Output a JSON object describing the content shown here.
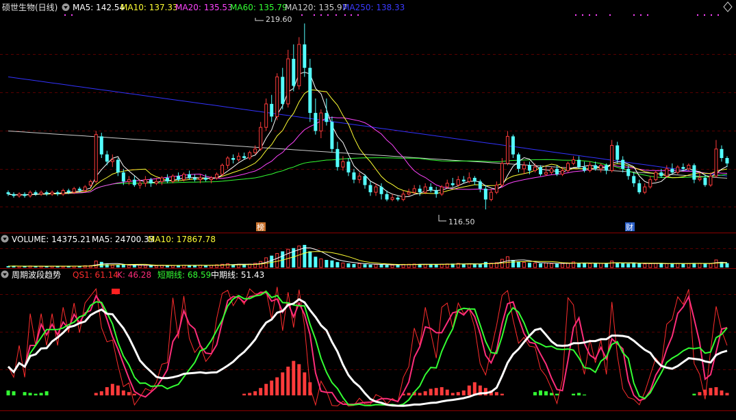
{
  "colors": {
    "up": "#ff3b3b",
    "down": "#54ffff",
    "grid": "#5a0000",
    "ma5": "#ffffff",
    "ma10": "#ffff33",
    "ma20": "#ff44ff",
    "ma60": "#33ff33",
    "ma120": "#cccccc",
    "ma250": "#3333ff",
    "qs1": "#ff2d2d",
    "k": "#ff2d7a",
    "short": "#33ff33",
    "mid": "#ffffff"
  },
  "header": {
    "title": "硕世生物(日线)",
    "ma5": "MA5: 142.54",
    "ma10": "MA10: 137.33",
    "ma20": "MA20: 135.53",
    "ma60": "MA60: 135.79",
    "ma120": "MA120: 135.97",
    "ma250": "MA250: 138.33"
  },
  "price_panel": {
    "high_label": "219.60",
    "low_label": "116.50",
    "marker1": "榜",
    "marker2": "财"
  },
  "volume_panel": {
    "label": "VOLUME: 14375.21",
    "ma5": "MA5: 24700.33",
    "ma10": "MA10: 17867.78"
  },
  "indicator_panel": {
    "name": "周期波段趋势",
    "qs1": "QS1: 61.14",
    "k": "K: 46.28",
    "short": "短期线: 68.59",
    "mid": "中期线: 51.43"
  },
  "chart_data": {
    "type": "candlestick",
    "candles": [
      [
        126,
        125,
        127,
        124
      ],
      [
        125,
        124,
        126,
        123
      ],
      [
        124,
        125,
        126,
        123
      ],
      [
        125,
        124,
        126,
        123
      ],
      [
        124,
        126,
        127,
        123
      ],
      [
        126,
        125,
        127,
        124
      ],
      [
        125,
        126,
        127,
        124
      ],
      [
        126,
        125,
        127,
        124
      ],
      [
        125,
        126,
        127,
        124
      ],
      [
        126,
        125,
        127,
        124
      ],
      [
        125,
        127,
        128,
        124
      ],
      [
        127,
        126,
        128,
        125
      ],
      [
        126,
        128,
        129,
        125
      ],
      [
        128,
        127,
        129,
        126
      ],
      [
        127,
        129,
        130,
        126
      ],
      [
        130,
        132,
        133,
        129
      ],
      [
        132,
        158,
        160,
        131
      ],
      [
        157,
        147,
        159,
        145
      ],
      [
        147,
        143,
        149,
        141
      ],
      [
        143,
        144,
        147,
        140
      ],
      [
        144,
        137,
        145,
        135
      ],
      [
        137,
        132,
        139,
        130
      ],
      [
        132,
        133,
        135,
        130
      ],
      [
        133,
        130,
        135,
        129
      ],
      [
        130,
        131,
        133,
        128
      ],
      [
        131,
        133,
        135,
        129
      ],
      [
        133,
        131,
        134,
        129
      ],
      [
        131,
        132,
        134,
        130
      ],
      [
        132,
        134,
        135,
        130
      ],
      [
        134,
        132,
        136,
        131
      ],
      [
        132,
        135,
        136,
        131
      ],
      [
        135,
        133,
        137,
        132
      ],
      [
        133,
        136,
        137,
        132
      ],
      [
        136,
        134,
        138,
        133
      ],
      [
        134,
        133,
        136,
        132
      ],
      [
        133,
        134,
        136,
        131
      ],
      [
        134,
        133,
        136,
        132
      ],
      [
        133,
        134,
        135,
        131
      ],
      [
        134,
        136,
        137,
        133
      ],
      [
        136,
        141,
        142,
        135
      ],
      [
        141,
        145,
        146,
        139
      ],
      [
        145,
        144,
        147,
        142
      ],
      [
        144,
        146,
        148,
        143
      ],
      [
        146,
        145,
        148,
        144
      ],
      [
        145,
        148,
        149,
        144
      ],
      [
        148,
        150,
        152,
        147
      ],
      [
        150,
        162,
        165,
        149
      ],
      [
        162,
        175,
        178,
        160
      ],
      [
        175,
        168,
        180,
        165
      ],
      [
        168,
        190,
        192,
        166
      ],
      [
        190,
        175,
        195,
        172
      ],
      [
        175,
        200,
        205,
        173
      ],
      [
        200,
        185,
        208,
        182
      ],
      [
        185,
        208,
        212,
        183
      ],
      [
        208,
        195,
        219.6,
        190
      ],
      [
        195,
        170,
        200,
        165
      ],
      [
        170,
        160,
        178,
        158
      ],
      [
        160,
        170,
        172,
        156
      ],
      [
        170,
        165,
        178,
        163
      ],
      [
        165,
        150,
        168,
        148
      ],
      [
        150,
        140,
        154,
        138
      ],
      [
        140,
        143,
        146,
        138
      ],
      [
        143,
        137,
        145,
        135
      ],
      [
        137,
        133,
        139,
        131
      ],
      [
        133,
        135,
        137,
        131
      ],
      [
        135,
        130,
        136,
        128
      ],
      [
        130,
        126,
        132,
        124
      ],
      [
        126,
        129,
        131,
        124
      ],
      [
        129,
        125,
        131,
        122
      ],
      [
        125,
        122,
        127,
        121
      ],
      [
        122,
        123,
        125,
        121
      ],
      [
        123,
        122,
        124,
        121
      ],
      [
        122,
        125,
        127,
        121
      ],
      [
        125,
        126,
        128,
        124
      ],
      [
        126,
        128,
        130,
        125
      ],
      [
        128,
        126,
        130,
        124
      ],
      [
        126,
        129,
        131,
        125
      ],
      [
        129,
        127,
        131,
        126
      ],
      [
        127,
        125,
        129,
        123
      ],
      [
        125,
        129,
        130,
        124
      ],
      [
        129,
        131,
        133,
        128
      ],
      [
        131,
        130,
        134,
        129
      ],
      [
        130,
        133,
        135,
        129
      ],
      [
        133,
        132,
        135,
        131
      ],
      [
        132,
        134,
        137,
        131
      ],
      [
        134,
        132,
        135,
        130
      ],
      [
        132,
        128,
        133,
        126
      ],
      [
        128,
        122,
        130,
        116.5
      ],
      [
        122,
        126,
        128,
        121
      ],
      [
        126,
        130,
        132,
        125
      ],
      [
        130,
        142,
        145,
        129
      ],
      [
        142,
        157,
        160,
        141
      ],
      [
        157,
        147,
        158,
        145
      ],
      [
        147,
        139,
        148,
        137
      ],
      [
        139,
        141,
        143,
        136
      ],
      [
        141,
        138,
        143,
        136
      ],
      [
        138,
        140,
        142,
        137
      ],
      [
        140,
        136,
        141,
        135
      ],
      [
        136,
        137,
        140,
        135
      ],
      [
        137,
        139,
        140,
        136
      ],
      [
        139,
        136,
        141,
        135
      ],
      [
        136,
        138,
        140,
        135
      ],
      [
        138,
        142,
        143,
        137
      ],
      [
        142,
        144,
        146,
        141
      ],
      [
        144,
        140,
        146,
        139
      ],
      [
        140,
        138,
        143,
        137
      ],
      [
        138,
        141,
        143,
        137
      ],
      [
        141,
        139,
        143,
        138
      ],
      [
        139,
        141,
        142,
        137
      ],
      [
        141,
        138,
        142,
        136
      ],
      [
        138,
        152,
        155,
        137
      ],
      [
        152,
        144,
        154,
        142
      ],
      [
        144,
        139,
        146,
        137
      ],
      [
        139,
        135,
        141,
        133
      ],
      [
        135,
        131,
        137,
        129
      ],
      [
        131,
        126,
        133,
        125
      ],
      [
        126,
        129,
        131,
        125
      ],
      [
        129,
        133,
        135,
        128
      ],
      [
        133,
        137,
        138,
        132
      ],
      [
        137,
        135,
        139,
        134
      ],
      [
        135,
        139,
        141,
        134
      ],
      [
        139,
        137,
        142,
        136
      ],
      [
        137,
        140,
        141,
        136
      ],
      [
        140,
        139,
        142,
        138
      ],
      [
        139,
        141,
        142,
        138
      ],
      [
        141,
        133,
        142,
        131
      ],
      [
        133,
        134,
        137,
        132
      ],
      [
        134,
        130,
        136,
        129
      ],
      [
        130,
        135,
        137,
        129
      ],
      [
        135,
        150,
        155,
        134
      ],
      [
        150,
        145,
        152,
        143
      ],
      [
        145,
        142,
        146,
        140
      ]
    ],
    "volumes": [
      120,
      150,
      110,
      100,
      140,
      90,
      130,
      110,
      120,
      140,
      100,
      150,
      120,
      130,
      160,
      180,
      600,
      520,
      300,
      210,
      220,
      280,
      200,
      190,
      210,
      180,
      170,
      160,
      210,
      190,
      180,
      230,
      200,
      210,
      190,
      220,
      180,
      200,
      250,
      300,
      350,
      280,
      300,
      260,
      310,
      390,
      560,
      900,
      1100,
      1300,
      1500,
      1700,
      1800,
      2000,
      2100,
      1500,
      1000,
      800,
      700,
      650,
      500,
      420,
      380,
      330,
      350,
      300,
      260,
      280,
      250,
      240,
      220,
      260,
      290,
      300,
      320,
      310,
      290,
      300,
      280,
      300,
      330,
      360,
      380,
      320,
      350,
      300,
      320,
      520,
      400,
      450,
      760,
      1000,
      700,
      560,
      480,
      430,
      400,
      380,
      420,
      360,
      340,
      380,
      420,
      520,
      400,
      380,
      360,
      400,
      380,
      350,
      600,
      450,
      380,
      360,
      410,
      390,
      330,
      350,
      380,
      350,
      360,
      400,
      380,
      340,
      360,
      420,
      390,
      370,
      340,
      700,
      520,
      400
    ],
    "indicator": {
      "qs1_k_ylim": [
        0,
        100
      ],
      "momentum_bars": [
        6,
        5,
        0,
        4,
        3,
        2,
        3,
        5,
        0,
        0,
        0,
        0,
        0,
        0,
        0,
        0,
        3,
        5,
        10,
        14,
        12,
        6,
        4,
        2,
        0,
        0,
        0,
        0,
        0,
        0,
        0,
        0,
        0,
        0,
        0,
        0,
        0,
        0,
        0,
        0,
        0,
        0,
        0,
        2,
        3,
        5,
        9,
        14,
        18,
        22,
        28,
        35,
        42,
        38,
        28,
        16,
        0,
        0,
        0,
        0,
        0,
        0,
        0,
        0,
        0,
        0,
        0,
        0,
        0,
        0,
        0,
        0,
        2,
        3,
        4,
        3,
        5,
        8,
        9,
        10,
        7,
        3,
        4,
        6,
        12,
        16,
        12,
        9,
        6,
        4,
        2,
        0,
        0,
        0,
        0,
        0,
        4,
        6,
        5,
        3,
        2,
        0,
        0,
        2,
        3,
        1,
        0,
        0,
        0,
        0,
        0,
        0,
        0,
        0,
        0,
        0,
        0,
        0,
        0,
        0,
        0,
        0,
        0,
        0,
        0,
        2,
        4,
        7,
        9,
        10,
        6,
        3
      ]
    }
  }
}
